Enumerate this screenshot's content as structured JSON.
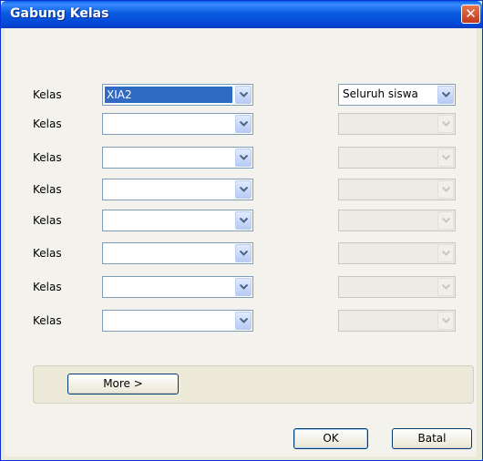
{
  "window": {
    "title": "Gabung Kelas",
    "close_glyph": "✕"
  },
  "rows": [
    {
      "label": "Kelas",
      "class_value": "XIA2",
      "scope_value": "Seluruh siswa",
      "scope_enabled": true
    },
    {
      "label": "Kelas",
      "class_value": "",
      "scope_value": "",
      "scope_enabled": false
    },
    {
      "label": "Kelas",
      "class_value": "",
      "scope_value": "",
      "scope_enabled": false
    },
    {
      "label": "Kelas",
      "class_value": "",
      "scope_value": "",
      "scope_enabled": false
    },
    {
      "label": "Kelas",
      "class_value": "",
      "scope_value": "",
      "scope_enabled": false
    },
    {
      "label": "Kelas",
      "class_value": "",
      "scope_value": "",
      "scope_enabled": false
    },
    {
      "label": "Kelas",
      "class_value": "",
      "scope_value": "",
      "scope_enabled": false
    },
    {
      "label": "Kelas",
      "class_value": "",
      "scope_value": "",
      "scope_enabled": false
    }
  ],
  "buttons": {
    "more": "More >",
    "ok": "OK",
    "cancel": "Batal"
  },
  "colors": {
    "titlebar": "#0a5ce0",
    "selection": "#316ac5",
    "close": "#c4391f"
  }
}
